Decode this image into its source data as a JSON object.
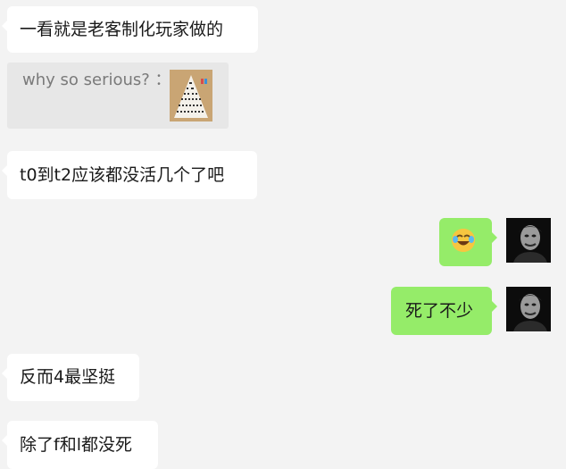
{
  "messages": [
    {
      "side": "left",
      "text": "一看就是老客制化玩家做的"
    },
    {
      "type": "quote",
      "text": "why so serious? ：",
      "thumbnail": "pyramid-tier-chart-icon"
    },
    {
      "side": "left",
      "text": "t0到t2应该都没活几个了吧"
    },
    {
      "side": "right",
      "emoji": "rolling-laughing-emoji-icon",
      "avatar": "joker-avatar-icon"
    },
    {
      "side": "right",
      "text": "死了不少",
      "avatar": "joker-avatar-icon"
    },
    {
      "side": "left",
      "text": "反而4最坚挺"
    },
    {
      "side": "left",
      "text": "除了f和l都没死"
    }
  ],
  "colors": {
    "background": "#f3f3f3",
    "bubble_left": "#ffffff",
    "bubble_right": "#95ec69",
    "quote_bg": "#e7e7e7"
  }
}
